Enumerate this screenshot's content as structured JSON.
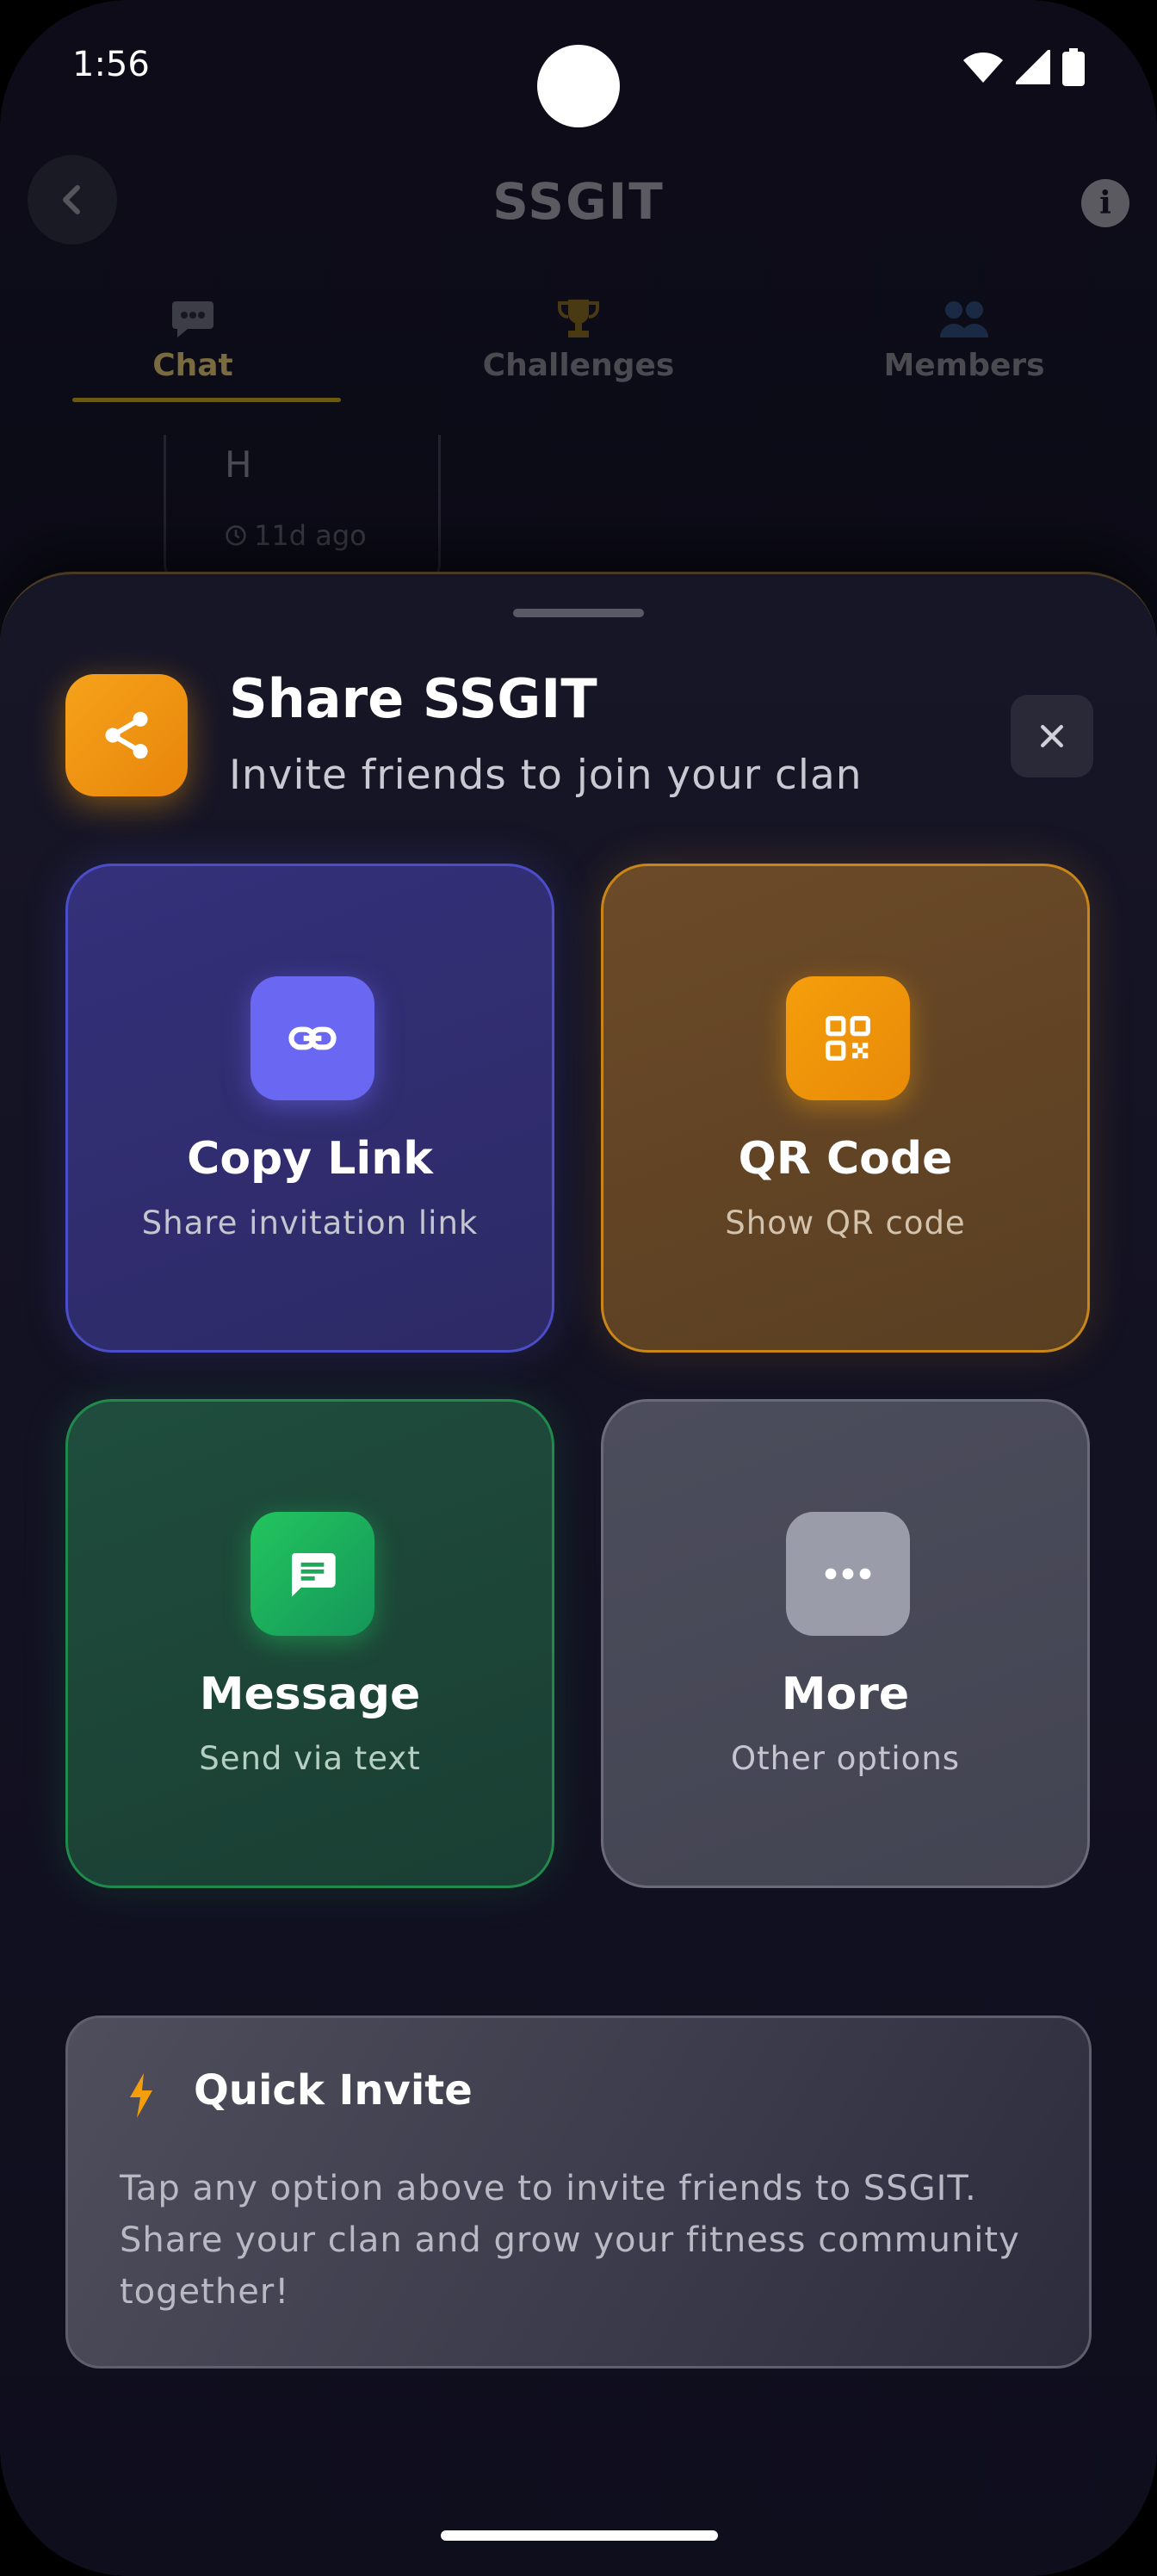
{
  "status_bar": {
    "time": "1:56"
  },
  "header": {
    "title": "SSGIT"
  },
  "tabs": [
    {
      "label": "Chat",
      "icon": "chat-bubble-icon"
    },
    {
      "label": "Challenges",
      "icon": "trophy-icon"
    },
    {
      "label": "Members",
      "icon": "members-icon"
    }
  ],
  "message": {
    "text": "H",
    "time": "11d ago"
  },
  "sheet": {
    "title": "Share SSGIT",
    "subtitle": "Invite friends to join your clan",
    "options": [
      {
        "title": "Copy Link",
        "subtitle": "Share invitation link",
        "icon": "link-icon",
        "accent": "#6a67f2"
      },
      {
        "title": "QR Code",
        "subtitle": "Show QR code",
        "icon": "qr-code-icon",
        "accent": "#f59e0b"
      },
      {
        "title": "Message",
        "subtitle": "Send via text",
        "icon": "message-icon",
        "accent": "#22c55e"
      },
      {
        "title": "More",
        "subtitle": "Other options",
        "icon": "more-dots-icon",
        "accent": "#9b9ca9"
      }
    ],
    "quick_invite": {
      "title": "Quick Invite",
      "body": "Tap any option above to invite friends to SSGIT. Share your clan and grow your fitness community together!"
    }
  }
}
